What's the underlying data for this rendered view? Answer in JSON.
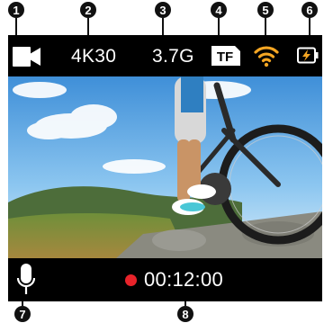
{
  "callouts": [
    "1",
    "2",
    "3",
    "4",
    "5",
    "6",
    "7",
    "8"
  ],
  "status_bar": {
    "mode_icon": "video-camera-icon",
    "resolution": "4K30",
    "storage": "3.7G",
    "card_icon": "tf-card-icon",
    "card_label": "TF",
    "wifi_icon": "wifi-icon",
    "battery_icon": "battery-charging-icon"
  },
  "bottom_bar": {
    "mic_icon": "microphone-icon",
    "record_time": "00:12:00"
  },
  "colors": {
    "bar_bg": "#000000",
    "text": "#ffffff",
    "wifi": "#f5a623",
    "battery_bolt": "#f5a623",
    "record_dot": "#e8232a",
    "callout": "#111111"
  }
}
